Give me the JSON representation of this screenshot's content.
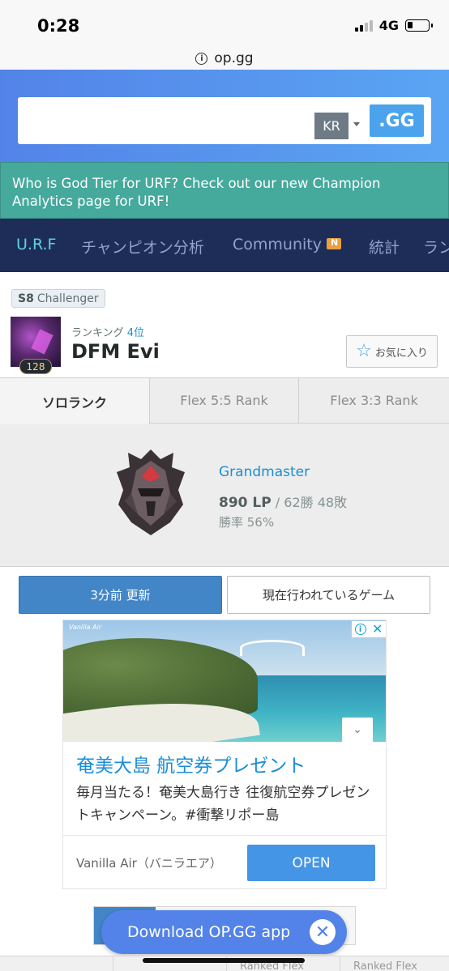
{
  "status_bar": {
    "time": "0:28",
    "network": "4G"
  },
  "browser": {
    "url": "op.gg"
  },
  "search": {
    "region": "KR",
    "submit_label": ".GG"
  },
  "notice": {
    "text": "Who is God Tier for URF? Check out our new Champion Analytics page for URF!"
  },
  "nav": {
    "items": [
      {
        "label": "U.R.F",
        "active": true
      },
      {
        "label": "チャンピオン分析"
      },
      {
        "label": "Community",
        "badge": "new-badge-icon"
      },
      {
        "label": "統計"
      },
      {
        "label": "ランキ"
      }
    ]
  },
  "profile": {
    "season": "S8",
    "season_tier": "Challenger",
    "level": "128",
    "ranking_label": "ランキング",
    "ranking_value": "4位",
    "summoner_name": "DFM Evi",
    "favorite_label": "お気に入り"
  },
  "rank_tabs": [
    {
      "label": "ソロランク",
      "active": true
    },
    {
      "label": "Flex 5:5 Rank"
    },
    {
      "label": "Flex 3:3 Rank"
    }
  ],
  "rank": {
    "tier": "Grandmaster",
    "lp": "890 LP",
    "record": "/ 62勝 48敗",
    "winrate": "勝率 56%"
  },
  "actions": {
    "update_label": "3分前 更新",
    "ingame_label": "現在行われているゲーム"
  },
  "ad": {
    "brand": "Vanilla Air",
    "title": "奄美大島 航空券プレゼント",
    "description": "毎月当たる！奄美大島行き 往復航空券プレゼントキャンペーン。#衝撃リポー島",
    "advertiser": "Vanilla Air（バニラエア）",
    "cta": "OPEN"
  },
  "app_banner": {
    "label": "Download OP.GG app"
  },
  "bottom_tabs": [
    "Ranked Flex",
    "Ranked Flex"
  ],
  "colors": {
    "brand_blue": "#5383e8",
    "nav_bg": "#1e2d57",
    "notice_bg": "#45a99c",
    "link_blue": "#1f8ecd"
  }
}
